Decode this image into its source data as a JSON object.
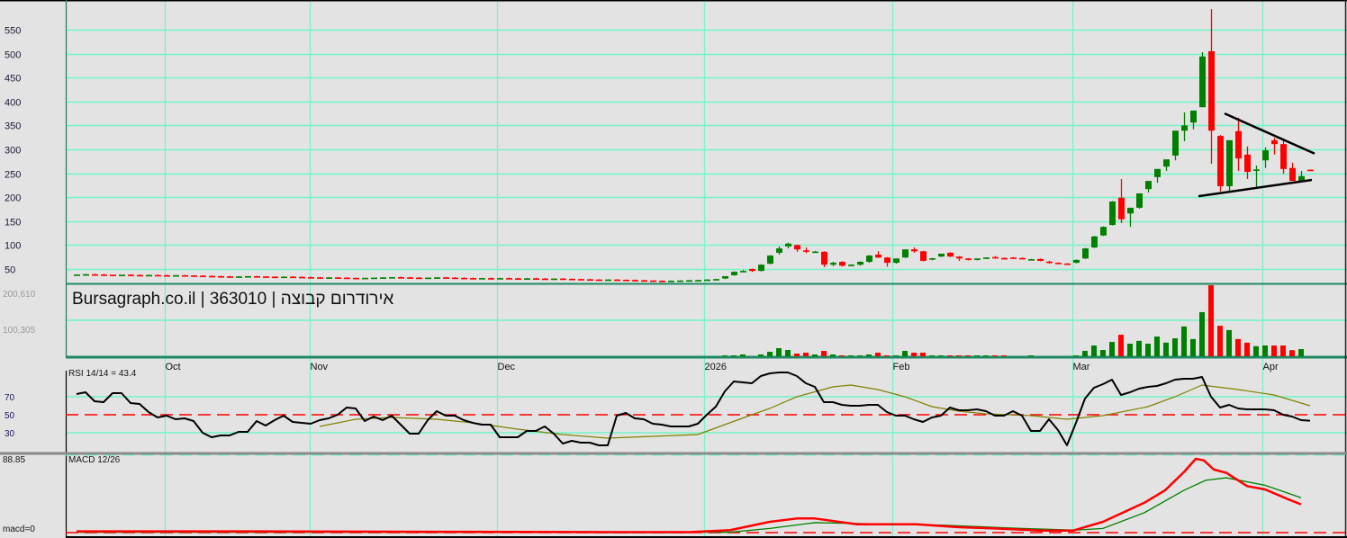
{
  "chart_data": {
    "type": "candlestick",
    "title": "Bursagraph.co.il | 363010 | אירודרום קבוצה",
    "colors": {
      "up": "#008000",
      "down": "#ff0000",
      "rsi": "#000000",
      "rsi_signal": "#808000",
      "macd": "#ff0000",
      "macd_signal": "#008000",
      "grid": "#73f5c8"
    },
    "price_axis": {
      "ticks": [
        50,
        100,
        150,
        200,
        250,
        300,
        350,
        400,
        450,
        500,
        550
      ],
      "ylim": [
        50,
        550
      ]
    },
    "x_ticks": [
      {
        "label": "Oct",
        "index": 9.8
      },
      {
        "label": "Nov",
        "index": 25.9
      },
      {
        "label": "Dec",
        "index": 46.7
      },
      {
        "label": "2026",
        "index": 69.7
      },
      {
        "label": "Feb",
        "index": 90.6
      },
      {
        "label": "Mar",
        "index": 110.6
      },
      {
        "label": "Apr",
        "index": 131.7
      }
    ],
    "candles_ohlc": [
      [
        38,
        38.5,
        37.5,
        38.5
      ],
      [
        38.5,
        40,
        37.5,
        39
      ],
      [
        39,
        40,
        38,
        38.5
      ],
      [
        38.5,
        39.5,
        37.5,
        38
      ],
      [
        38,
        38,
        37.5,
        37.5
      ],
      [
        37.5,
        38,
        36.5,
        38
      ],
      [
        38,
        39,
        37,
        37.5
      ],
      [
        37.5,
        38.5,
        36.5,
        37
      ],
      [
        37,
        38,
        36,
        37.5
      ],
      [
        37.5,
        38.5,
        36.5,
        37
      ],
      [
        37,
        38,
        36,
        36.5
      ],
      [
        36.5,
        37.5,
        36,
        37
      ],
      [
        37,
        37.5,
        36,
        36.5
      ],
      [
        36.5,
        37,
        36,
        36
      ],
      [
        36,
        37,
        35,
        35.5
      ],
      [
        35.5,
        36.5,
        34.5,
        35
      ],
      [
        35,
        36,
        34,
        34.5
      ],
      [
        34.5,
        35.5,
        33.5,
        34
      ],
      [
        34,
        35,
        33.5,
        34.5
      ],
      [
        34.5,
        35.5,
        33.5,
        35
      ],
      [
        35,
        35.5,
        34,
        34.5
      ],
      [
        34.5,
        35,
        34,
        34
      ],
      [
        34,
        34.5,
        33.5,
        33.5
      ],
      [
        33.5,
        34.5,
        33,
        34
      ],
      [
        34,
        35,
        33,
        33.5
      ],
      [
        33.5,
        34.5,
        32.5,
        33
      ],
      [
        33,
        34,
        32,
        32.5
      ],
      [
        32.5,
        33.5,
        31.5,
        32
      ],
      [
        32,
        33,
        31,
        32.5
      ],
      [
        32.5,
        33,
        32,
        32
      ],
      [
        32,
        32.5,
        31.5,
        31.5
      ],
      [
        31.5,
        32,
        31,
        31
      ],
      [
        31,
        32,
        30,
        31.5
      ],
      [
        31.5,
        32,
        31,
        32
      ],
      [
        32,
        33,
        31,
        32.5
      ],
      [
        32.5,
        33,
        32,
        33
      ],
      [
        33,
        34,
        32,
        32.5
      ],
      [
        32.5,
        33.5,
        31.5,
        32
      ],
      [
        32,
        33,
        31,
        31.5
      ],
      [
        31.5,
        32,
        31,
        32
      ],
      [
        32,
        33,
        31,
        32.5
      ],
      [
        32.5,
        33.5,
        31.5,
        32
      ],
      [
        32,
        33,
        31,
        31.5
      ],
      [
        31.5,
        32.5,
        30.5,
        31
      ],
      [
        31,
        32,
        30,
        30.5
      ],
      [
        30.5,
        31.5,
        29.5,
        31
      ],
      [
        31,
        32,
        30,
        30.5
      ],
      [
        30.5,
        31.5,
        29.5,
        31
      ],
      [
        31,
        32,
        30,
        30.5
      ],
      [
        30.5,
        31.5,
        29.5,
        30
      ],
      [
        30,
        31,
        29,
        30.5
      ],
      [
        30.5,
        31.5,
        29.5,
        30
      ],
      [
        30,
        31,
        29,
        29.5
      ],
      [
        29.5,
        30.5,
        28.5,
        30
      ],
      [
        30,
        31,
        29,
        29.5
      ],
      [
        29.5,
        30,
        29,
        29
      ],
      [
        29,
        29.5,
        28.5,
        28.5
      ],
      [
        28.5,
        29.5,
        27.5,
        28
      ],
      [
        28,
        28.5,
        27.5,
        27.5
      ],
      [
        27.5,
        28.5,
        27,
        28
      ],
      [
        28,
        28.5,
        27.5,
        27.5
      ],
      [
        27.5,
        28,
        27,
        27
      ],
      [
        27,
        28,
        26,
        26.5
      ],
      [
        26.5,
        27.5,
        26,
        26
      ],
      [
        26,
        26.5,
        25.5,
        25.5
      ],
      [
        25.5,
        26.5,
        25,
        25
      ],
      [
        25,
        26,
        24.5,
        25.5
      ],
      [
        25.5,
        26.5,
        25,
        26
      ],
      [
        26,
        27,
        25,
        26.5
      ],
      [
        26.5,
        27.5,
        26,
        27
      ],
      [
        27,
        28.5,
        26.5,
        28
      ],
      [
        28,
        29.5,
        27.5,
        29
      ],
      [
        30,
        35,
        29,
        35
      ],
      [
        37,
        45,
        36,
        44
      ],
      [
        45,
        48,
        44,
        46
      ],
      [
        50,
        51,
        44,
        46
      ],
      [
        46,
        60,
        45,
        59
      ],
      [
        61,
        79,
        60,
        78
      ],
      [
        84,
        97,
        80,
        93
      ],
      [
        97,
        105,
        93,
        103
      ],
      [
        100,
        101,
        86,
        91
      ],
      [
        89,
        95,
        83,
        86
      ],
      [
        86,
        88,
        84,
        86.5
      ],
      [
        86,
        87,
        54,
        59
      ],
      [
        59,
        65,
        56,
        63
      ],
      [
        65,
        66,
        55,
        57
      ],
      [
        58,
        60,
        56,
        59
      ],
      [
        59,
        66,
        57,
        65
      ],
      [
        65,
        79,
        63,
        78
      ],
      [
        80,
        87,
        73,
        74
      ],
      [
        74,
        75,
        55,
        63
      ],
      [
        63,
        72,
        61,
        72
      ],
      [
        74,
        91,
        73,
        91
      ],
      [
        91,
        95,
        84,
        87
      ],
      [
        87,
        88,
        66,
        67
      ],
      [
        72,
        73,
        68,
        72.5
      ],
      [
        76,
        82,
        75,
        82
      ],
      [
        84,
        85,
        75,
        76
      ],
      [
        76,
        77,
        67,
        72
      ],
      [
        72,
        73,
        68,
        69
      ],
      [
        69,
        72,
        68,
        72
      ],
      [
        72,
        74,
        71,
        74
      ],
      [
        75,
        77,
        72,
        74.5
      ],
      [
        73,
        74,
        70,
        72
      ],
      [
        74,
        75,
        72,
        72
      ],
      [
        73,
        74,
        70,
        72
      ],
      [
        70,
        71,
        68,
        70.5
      ],
      [
        71,
        72,
        66,
        67
      ],
      [
        65.5,
        67,
        61,
        65
      ],
      [
        63,
        64,
        62,
        62.5
      ],
      [
        61.5,
        62,
        60,
        61
      ],
      [
        63,
        70,
        62,
        69
      ],
      [
        72,
        94,
        71,
        93
      ],
      [
        95,
        119,
        94,
        118
      ],
      [
        120,
        139,
        119,
        138
      ],
      [
        142,
        192,
        141,
        191
      ],
      [
        199,
        238,
        146,
        154
      ],
      [
        166,
        178,
        138,
        178
      ],
      [
        178,
        208,
        176,
        208
      ],
      [
        217,
        234,
        210,
        234
      ],
      [
        242,
        259,
        230,
        259
      ],
      [
        264,
        279,
        255,
        279
      ],
      [
        287,
        339,
        277,
        339
      ],
      [
        339,
        377,
        317,
        350
      ],
      [
        356,
        381,
        342,
        381
      ],
      [
        388,
        503,
        388,
        494
      ],
      [
        505,
        593,
        270,
        339
      ],
      [
        328,
        330,
        212,
        223
      ],
      [
        223,
        319,
        212,
        319
      ],
      [
        338,
        366,
        255,
        281
      ],
      [
        289,
        306,
        238,
        253
      ],
      [
        256,
        266,
        219,
        258
      ],
      [
        277,
        304,
        261,
        298
      ],
      [
        319,
        324,
        289,
        311
      ],
      [
        311,
        322,
        249,
        259
      ],
      [
        261,
        272,
        234,
        234
      ],
      [
        234,
        255,
        234,
        244
      ],
      [
        257.5,
        257.5,
        256.5,
        257
      ]
    ],
    "volume_axis": {
      "labels": [
        "200,610",
        "100,305"
      ],
      "values": [
        200610,
        100305
      ]
    },
    "volume": [
      0,
      0,
      0,
      0,
      0,
      0,
      0,
      0,
      0,
      0,
      0,
      0,
      0,
      0,
      0,
      0,
      0,
      0,
      0,
      0,
      0,
      0,
      0,
      0,
      0,
      0,
      0,
      0,
      0,
      0,
      0,
      0,
      0,
      0,
      0,
      0,
      0,
      0,
      0,
      0,
      0,
      0,
      0,
      0,
      0,
      0,
      0,
      0,
      0,
      0,
      0,
      0,
      0,
      0,
      0,
      0,
      0,
      0,
      0,
      0,
      0,
      0,
      0,
      0,
      0,
      0,
      0,
      0,
      0,
      0,
      0,
      0,
      2500,
      2500,
      5000,
      0,
      5000,
      12500,
      22500,
      17500,
      7500,
      10000,
      5000,
      15000,
      5000,
      2500,
      2500,
      2500,
      5000,
      10000,
      2500,
      2500,
      15000,
      10000,
      10000,
      2500,
      2500,
      2500,
      2500,
      2500,
      2500,
      2500,
      2500,
      2500,
      0,
      0,
      2500,
      0,
      0,
      0,
      0,
      2500,
      15000,
      30000,
      17500,
      40000,
      60000,
      35000,
      43000,
      35000,
      55000,
      38000,
      50000,
      83000,
      48000,
      123000,
      198000,
      85000,
      73000,
      48000,
      38000,
      28000,
      30000,
      30000,
      30000,
      17000,
      20000,
      0
    ],
    "rsi": {
      "label": "RSI 14/14 = 43.4",
      "ticks": [
        70,
        50,
        30
      ],
      "reference": 50,
      "values": [
        73,
        75,
        65,
        64,
        74,
        74,
        63,
        62,
        53,
        47,
        49,
        45,
        46,
        43,
        30,
        25,
        27,
        27,
        31,
        31,
        43,
        38,
        44,
        49,
        42,
        41,
        40,
        44,
        46,
        50,
        58,
        57,
        43,
        48,
        44,
        49,
        39,
        29,
        29,
        44,
        54,
        49,
        49,
        44,
        41,
        39,
        39,
        25,
        25,
        25,
        32,
        32,
        37,
        29,
        18,
        21,
        19,
        19,
        16,
        16,
        49,
        52,
        46,
        45,
        40,
        39,
        37,
        37,
        37,
        40,
        50,
        59,
        76,
        87,
        86,
        85,
        93,
        96,
        97,
        97,
        93,
        85,
        81,
        64,
        64,
        61,
        60,
        60,
        61,
        61,
        53,
        49,
        49,
        45,
        42,
        47,
        49,
        58,
        55,
        55,
        56,
        54,
        49,
        49,
        54,
        49,
        32,
        32,
        45,
        33,
        16,
        41,
        68,
        80,
        84,
        89,
        72,
        75,
        79,
        81,
        82,
        85,
        89,
        90,
        90,
        92,
        70,
        58,
        61,
        57,
        56,
        56,
        56,
        55,
        50,
        48,
        44,
        43.4
      ],
      "signal": [
        [
          27,
          37
        ],
        [
          31,
          45
        ],
        [
          35,
          47
        ],
        [
          40,
          45
        ],
        [
          44,
          41
        ],
        [
          49,
          34
        ],
        [
          54,
          28
        ],
        [
          59,
          24
        ],
        [
          64,
          26
        ],
        [
          69,
          28
        ],
        [
          72,
          39
        ],
        [
          75,
          50
        ],
        [
          77,
          57
        ],
        [
          80,
          70
        ],
        [
          84,
          81
        ],
        [
          86,
          83
        ],
        [
          89,
          78
        ],
        [
          92,
          70
        ],
        [
          95,
          59
        ],
        [
          98,
          54
        ],
        [
          101,
          51
        ],
        [
          106,
          49
        ],
        [
          110,
          45
        ],
        [
          114,
          49
        ],
        [
          119,
          59
        ],
        [
          122,
          70
        ],
        [
          125,
          83
        ],
        [
          129,
          78
        ],
        [
          133,
          72
        ],
        [
          137,
          60
        ]
      ]
    },
    "macd": {
      "label": "MACD 12/26",
      "max_label": "88.85",
      "zero_label": "macd=0",
      "max": 88.85,
      "macd": [
        [
          0,
          1.5
        ],
        [
          20,
          1.5
        ],
        [
          40,
          1
        ],
        [
          60,
          0.5
        ],
        [
          68,
          0.5
        ],
        [
          72.6,
          3
        ],
        [
          77,
          13
        ],
        [
          80,
          17
        ],
        [
          82,
          17
        ],
        [
          86.7,
          10
        ],
        [
          91,
          10
        ],
        [
          93.3,
          10
        ],
        [
          98,
          6.5
        ],
        [
          102,
          5
        ],
        [
          107,
          2.5
        ],
        [
          110.7,
          2.5
        ],
        [
          114,
          13
        ],
        [
          118.6,
          36
        ],
        [
          120.9,
          51
        ],
        [
          123,
          73
        ],
        [
          124.3,
          88.85
        ],
        [
          125.2,
          87
        ],
        [
          126.3,
          76
        ],
        [
          127.7,
          72
        ],
        [
          130,
          56
        ],
        [
          132,
          52
        ],
        [
          134.6,
          40
        ],
        [
          136,
          34
        ]
      ],
      "signal": [
        [
          0,
          0.5
        ],
        [
          40,
          0.5
        ],
        [
          72.6,
          0.5
        ],
        [
          77,
          5
        ],
        [
          82,
          12
        ],
        [
          86.7,
          11
        ],
        [
          96,
          9
        ],
        [
          105,
          5
        ],
        [
          111,
          3
        ],
        [
          114,
          5
        ],
        [
          118.6,
          24
        ],
        [
          123,
          51
        ],
        [
          125.4,
          63
        ],
        [
          127.7,
          66
        ],
        [
          132,
          57
        ],
        [
          136,
          42
        ]
      ]
    },
    "trendlines": [
      {
        "name": "resistance",
        "from": [
          127.5,
          375
        ],
        "to": [
          137.5,
          291
        ]
      },
      {
        "name": "support",
        "from": [
          124.6,
          202
        ],
        "to": [
          137.2,
          236
        ]
      }
    ]
  }
}
